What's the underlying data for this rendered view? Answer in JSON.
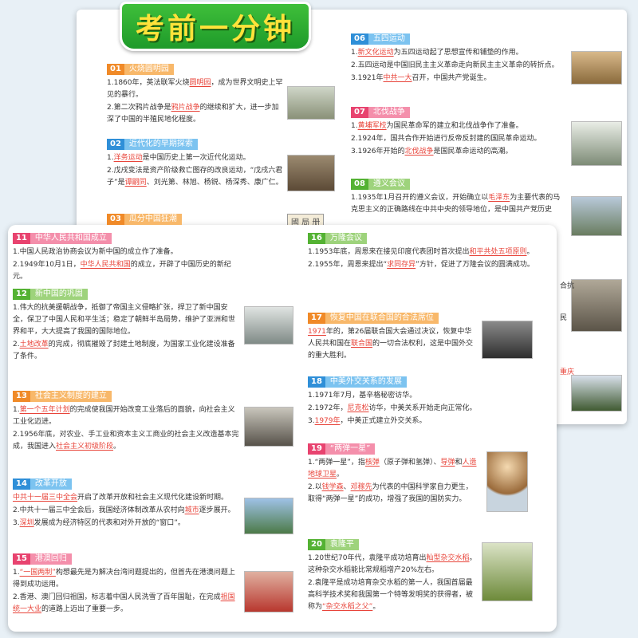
{
  "title": "考前一分钟",
  "stamp": "國 局 册",
  "back_left": [
    {
      "num": "01",
      "label": "火烧圆明园",
      "color": "orange",
      "items": [
        [
          "1.1860年，英法联军火烧",
          {
            "hl": "圆明园"
          },
          "，成为世界文明史上罕见的暴行。"
        ],
        [
          "2.第二次鸦片战争是",
          {
            "hl": "鸦片战争"
          },
          "的继续和扩大，进一步加深了中国的半殖民地化程度。"
        ]
      ]
    },
    {
      "num": "02",
      "label": "近代化的早期探索",
      "color": "blue",
      "items": [
        [
          "1.",
          {
            "hl": "洋务运动"
          },
          "是中国历史上第一次近代化运动。"
        ],
        [
          "2.戊戌变法是资产阶级救亡图存的改良运动，“戊戌六君子”是",
          {
            "hl": "谭嗣同"
          },
          "、刘光第、林旭、杨锐、杨深秀、康广仁。"
        ]
      ]
    },
    {
      "num": "03",
      "label": "瓜分中国狂潮",
      "color": "orange",
      "items": []
    }
  ],
  "back_right": [
    {
      "num": "06",
      "label": "五四运动",
      "color": "blue",
      "items": [
        [
          "1.",
          {
            "hl": "新文化运动"
          },
          "为五四运动起了思想宣传和铺垫的作用。"
        ],
        [
          "2.五四运动是中国旧民主主义革命走向新民主主义革命的转折点。"
        ],
        [
          "3.1921年",
          {
            "hl": "中共一大"
          },
          "召开，中国共产党诞生。"
        ]
      ]
    },
    {
      "num": "07",
      "label": "北伐战争",
      "color": "pink",
      "items": [
        [
          "1.",
          {
            "hl": "黄埔军校"
          },
          "为国民革命军的建立和北伐战争作了准备。"
        ],
        [
          "2.1924年，国共合作开始进行反帝反封建的国民革命运动。"
        ],
        [
          "3.1926年开始的",
          {
            "hl": "北伐战争"
          },
          "是国民革命运动的高潮。"
        ]
      ]
    },
    {
      "num": "08",
      "label": "遵义会议",
      "color": "green",
      "items": [
        [
          "1.1935年1月召开的遵义会议，开始确立以",
          {
            "hl": "毛泽东"
          },
          "为主要代表的马克思主义的正确路线在中共中央的领导地位，是中国共产党历史"
        ]
      ]
    }
  ],
  "back_fragments": [
    "合抗",
    "民",
    "重庆"
  ],
  "front_left": [
    {
      "num": "11",
      "label": "中华人民共和国成立",
      "color": "pink",
      "items": [
        [
          "1.中国人民政治协商会议为新中国的成立作了准备。"
        ],
        [
          "2.1949年10月1日，",
          {
            "hl": "中华人民共和国"
          },
          "的成立，开辟了中国历史的新纪元。"
        ]
      ]
    },
    {
      "num": "12",
      "label": "新中国的巩固",
      "color": "green",
      "items": [
        [
          "1.伟大的抗美援朝战争，抵御了帝国主义侵略扩张，捍卫了新中国安全，保卫了中国人民和平生活；稳定了朝鲜半岛局势，维护了亚洲和世界和平，大大提高了我国的国际地位。"
        ],
        [
          "2.",
          {
            "hl": "土地改革"
          },
          "的完成，彻底摧毁了封建土地制度，为国家工业化建设准备了条件。"
        ]
      ]
    },
    {
      "num": "13",
      "label": "社会主义制度的建立",
      "color": "orange",
      "items": [
        [
          "1.",
          {
            "hl": "第一个五年计划"
          },
          "的完成使我国开始改变工业落后的面貌，向社会主义工业化迈进。"
        ],
        [
          "2.1956年底，对农业、手工业和资本主义工商业的社会主义改造基本完成，我国进入",
          {
            "hl": "社会主义初级阶段"
          },
          "。"
        ]
      ]
    },
    {
      "num": "14",
      "label": "改革开放",
      "color": "blue",
      "items": [
        [
          {
            "hl": "中共十一届三中全会"
          },
          "开启了改革开放和社会主义现代化建设新时期。"
        ],
        [
          "2.中共十一届三中全会后，我国经济体制改革从农村向",
          {
            "hl": "城市"
          },
          "逐步展开。"
        ],
        [
          "3.",
          {
            "hl": "深圳"
          },
          "发展成为经济特区的代表和对外开放的“窗口”。"
        ]
      ]
    },
    {
      "num": "15",
      "label": "港澳回归",
      "color": "pink",
      "items": [
        [
          "1.",
          {
            "hl": "“一国两制”"
          },
          "构想最先是为解决台湾问题提出的，但首先在港澳问题上得到成功运用。"
        ],
        [
          "2.香港、澳门回归祖国，标志着中国人民洗雪了百年国耻，在完成",
          {
            "hl": "祖国统一大业"
          },
          "的道路上迈出了重要一步。"
        ]
      ]
    }
  ],
  "front_right": [
    {
      "num": "16",
      "label": "万隆会议",
      "color": "green",
      "items": [
        [
          "1.1953年底，周恩来在接见印度代表团时首次提出",
          {
            "hl": "和平共处五项原则"
          },
          "。"
        ],
        [
          "2.1955年，周恩来提出“",
          {
            "hl": "求同存异"
          },
          "”方针，促进了万隆会议的圆满成功。"
        ]
      ]
    },
    {
      "num": "17",
      "label": "恢复中国在联合国的合法席位",
      "color": "orange",
      "items": [
        [
          {
            "hl": "1971"
          },
          "年的，第26届联合国大会通过决议，恢复中华人民共和国在",
          {
            "hl": "联合国"
          },
          "的一切合法权利，这是中国外交的重大胜利。"
        ]
      ]
    },
    {
      "num": "18",
      "label": "中美外交关系的发展",
      "color": "blue",
      "items": [
        [
          "1.1971年7月，基辛格秘密访华。"
        ],
        [
          "2.1972年，",
          {
            "hl": "尼克松"
          },
          "访华，中美关系开始走向正常化。"
        ],
        [
          "3.",
          {
            "hl": "1979年"
          },
          "，中美正式建立外交关系。"
        ]
      ]
    },
    {
      "num": "19",
      "label": "“两弹一星”",
      "color": "pink",
      "items": [
        [
          "1.“两弹一星”，指",
          {
            "hl": "核弹"
          },
          "（原子弹和氢弹）、",
          {
            "hl": "导弹"
          },
          "和",
          {
            "hl": "人造地球卫星"
          },
          "。"
        ],
        [
          "2.以",
          {
            "hl": "钱学森"
          },
          "、",
          {
            "hl": "邓稼先"
          },
          "为代表的中国科学家自力更生，取得“两弹一星”的成功，增强了我国的国防实力。"
        ]
      ]
    },
    {
      "num": "20",
      "label": "袁隆平",
      "color": "green",
      "items": [
        [
          "1.20世纪70年代，袁隆平成功培育出",
          {
            "hl": "籼型杂交水稻"
          },
          "。这种杂交水稻能比常规稻增产20%左右。"
        ],
        [
          "2.袁隆平是成功培育杂交水稻的第一人，我国首届最高科学技术奖和我国第一个特等发明奖的获得者，被称为",
          {
            "hl": "“杂交水稻之父”"
          },
          "。"
        ]
      ]
    }
  ]
}
